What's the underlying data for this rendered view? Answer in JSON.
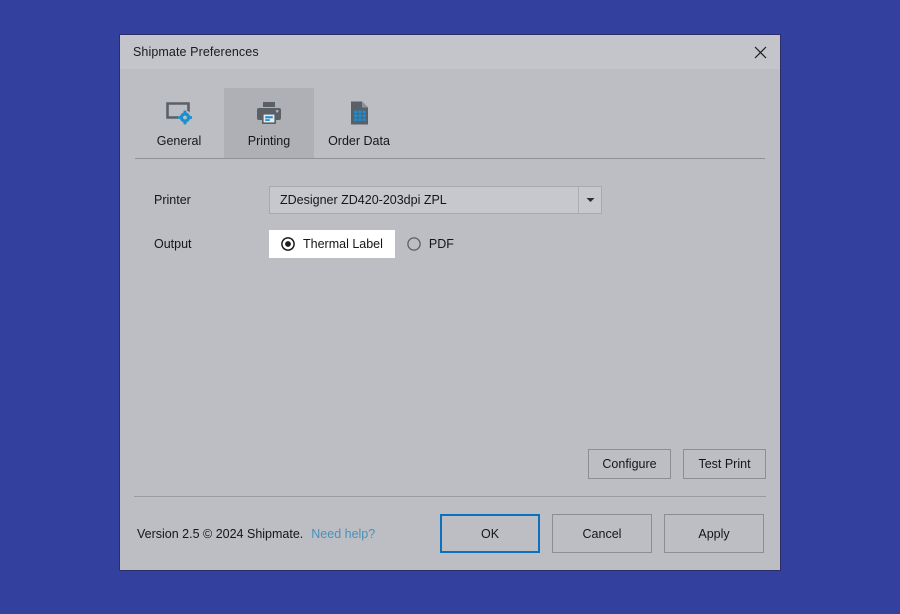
{
  "window": {
    "title": "Shipmate Preferences",
    "close_icon": "close-icon"
  },
  "tabs": [
    {
      "label": "General",
      "icon": "window-settings-icon",
      "active": false
    },
    {
      "label": "Printing",
      "icon": "printer-icon",
      "active": true
    },
    {
      "label": "Order Data",
      "icon": "document-grid-icon",
      "active": false
    }
  ],
  "form": {
    "printer": {
      "label": "Printer",
      "selected": "ZDesigner ZD420-203dpi ZPL",
      "arrow_icon": "chevron-down-icon"
    },
    "output": {
      "label": "Output",
      "options": [
        {
          "label": "Thermal Label",
          "selected": true,
          "highlighted": true
        },
        {
          "label": "PDF",
          "selected": false,
          "highlighted": false
        }
      ]
    }
  },
  "actions": {
    "configure_label": "Configure",
    "test_print_label": "Test Print"
  },
  "footer": {
    "version_text": "Version 2.5 © 2024 Shipmate.",
    "help_link": "Need help?",
    "ok_label": "OK",
    "cancel_label": "Cancel",
    "apply_label": "Apply"
  },
  "colors": {
    "desktop": "#34409e",
    "dialog_bg": "#bcbec3",
    "titlebar_bg": "#c3c5ca",
    "active_tab_bg": "#aeb0b5",
    "accent_blue": "#0a72bd",
    "icon_blue": "#1a8fd1",
    "icon_gray": "#5b6067",
    "link_blue": "#4a91b8"
  }
}
